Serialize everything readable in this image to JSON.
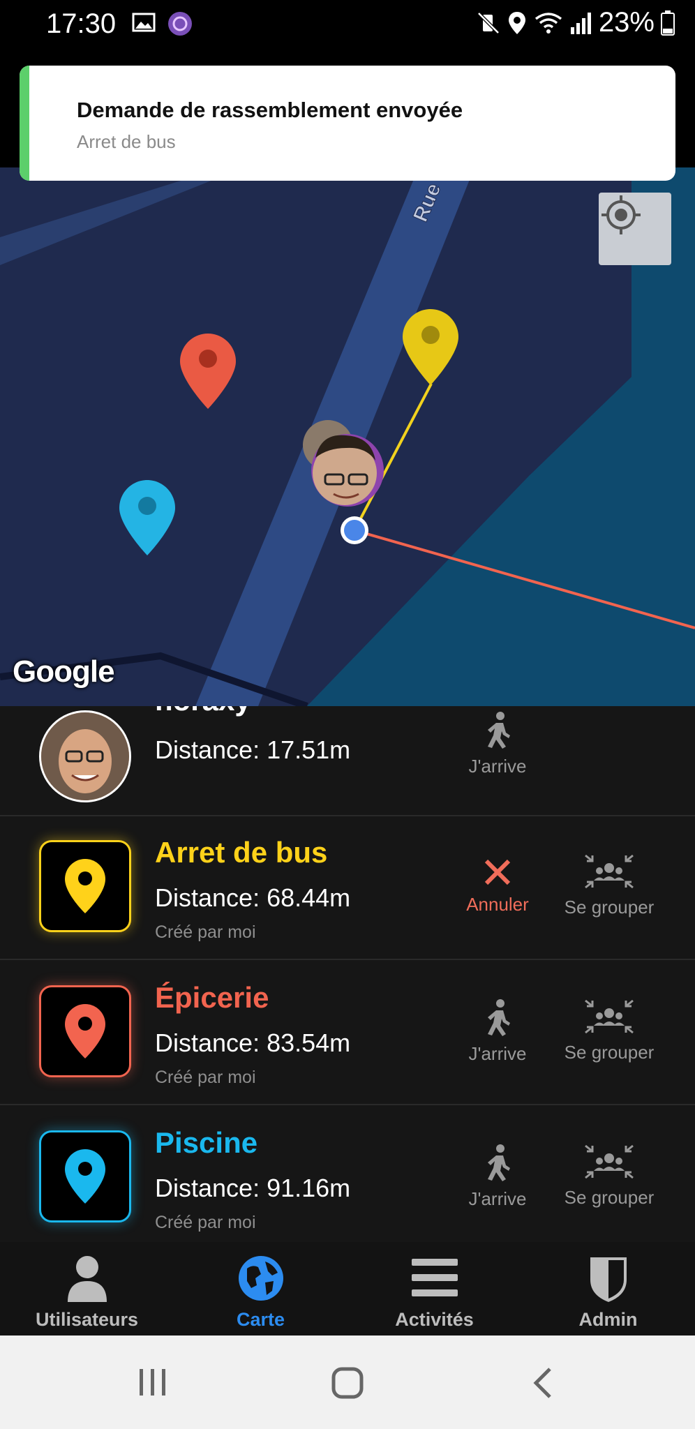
{
  "status_bar": {
    "time": "17:30",
    "battery": "23%"
  },
  "toast": {
    "title": "Demande de rassemblement envoyée",
    "subtitle": "Arret de bus"
  },
  "map": {
    "street_label": "Rue",
    "logo": "Google"
  },
  "list": {
    "partial_row": {
      "name": "noraxy",
      "distance": "Distance: 17.51m",
      "action_arrive": "J'arrive"
    },
    "rows": [
      {
        "name": "Arret de bus",
        "distance": "Distance: 68.44m",
        "creator": "Créé par moi",
        "color": "#ffd21a",
        "action1": "Annuler",
        "action2": "Se grouper"
      },
      {
        "name": "Épicerie",
        "distance": "Distance: 83.54m",
        "creator": "Créé par moi",
        "color": "#f2644f",
        "action1": "J'arrive",
        "action2": "Se grouper"
      },
      {
        "name": "Piscine",
        "distance": "Distance: 91.16m",
        "creator": "Créé par moi",
        "color": "#1ab8ee",
        "action1": "J'arrive",
        "action2": "Se grouper"
      }
    ]
  },
  "nav": {
    "items": [
      {
        "label": "Utilisateurs",
        "icon": "user-icon"
      },
      {
        "label": "Carte",
        "icon": "globe-icon",
        "active": true,
        "color": "#2c8cf0"
      },
      {
        "label": "Activités",
        "icon": "menu-icon"
      },
      {
        "label": "Admin",
        "icon": "shield-icon"
      }
    ]
  }
}
